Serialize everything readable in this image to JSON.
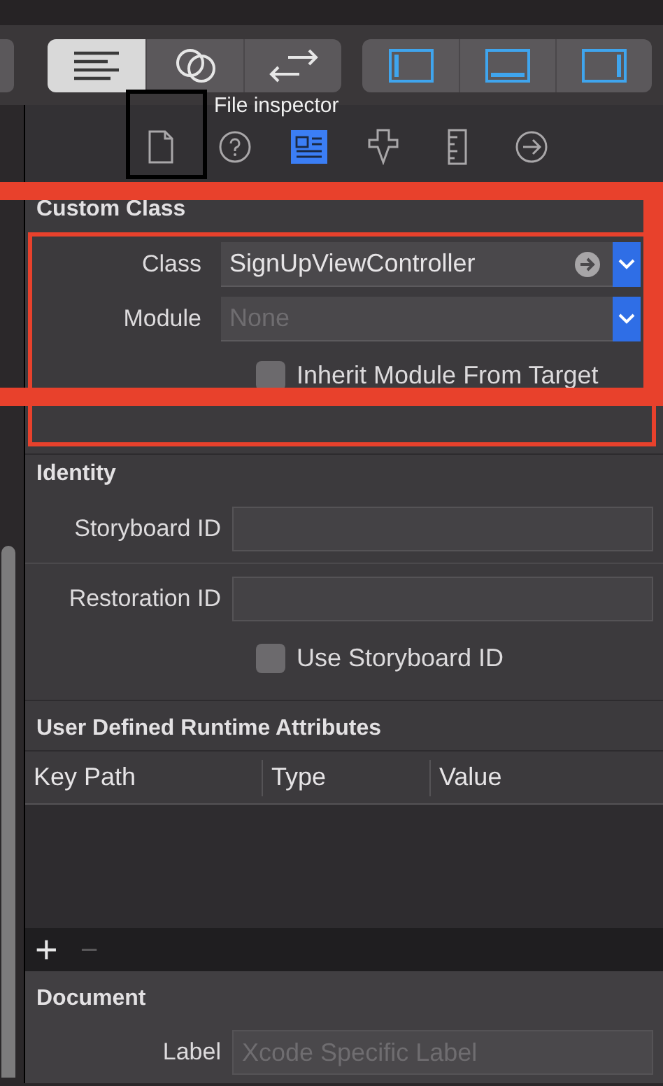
{
  "toolbar": {
    "editor_modes": [
      {
        "selected": true
      },
      {
        "selected": false
      },
      {
        "selected": false
      }
    ],
    "panels": [
      {
        "selected": true
      },
      {
        "selected": true
      },
      {
        "selected": true
      }
    ]
  },
  "inspector_tabs": [
    {
      "selected": false
    },
    {
      "selected": false
    },
    {
      "selected": true
    },
    {
      "selected": false
    },
    {
      "selected": false
    },
    {
      "selected": false
    }
  ],
  "tooltip": "File inspector",
  "custom_class": {
    "title": "Custom Class",
    "fields": [
      {
        "label": "Class",
        "value": "SignUpViewController",
        "go_arrow": true
      },
      {
        "label": "Module",
        "placeholder": "None",
        "go_arrow": false
      }
    ],
    "checkbox": {
      "label": "Inherit Module From Target",
      "checked": false
    }
  },
  "identity": {
    "title": "Identity",
    "fields": [
      {
        "label": "Storyboard ID"
      },
      {
        "label": "Restoration ID"
      }
    ],
    "checkbox": {
      "label": "Use Storyboard ID",
      "checked": false
    }
  },
  "runtime_attributes": {
    "title": "User Defined Runtime Attributes",
    "columns": [
      "Key Path",
      "Type",
      "Value"
    ],
    "add": "+",
    "remove": "−"
  },
  "document": {
    "title": "Document",
    "label": "Label",
    "placeholder": "Xcode Specific Label"
  }
}
